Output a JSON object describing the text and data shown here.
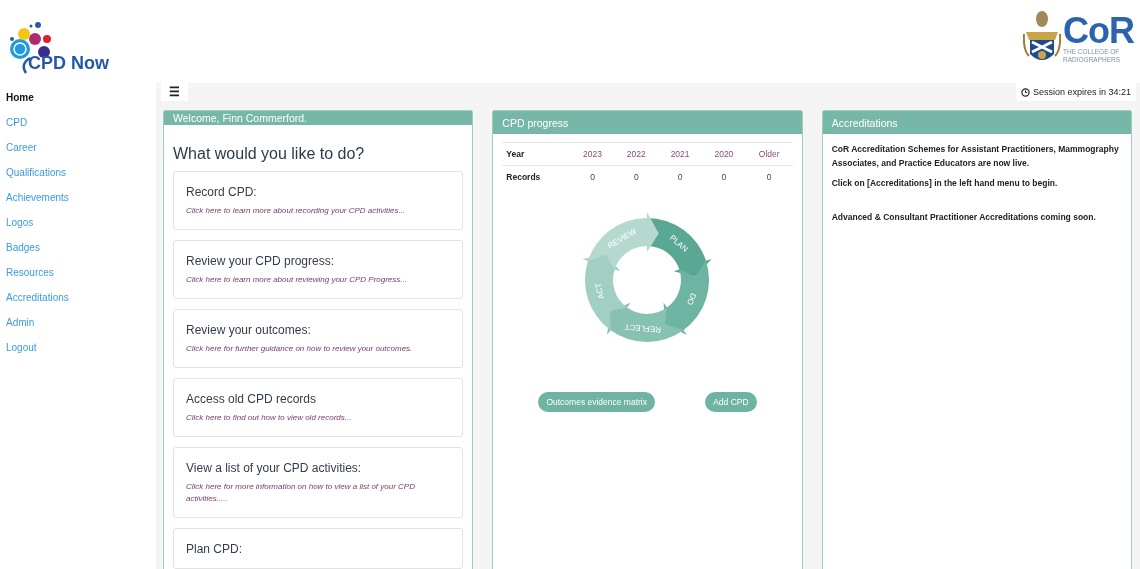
{
  "header": {
    "app_logo_text": "CPD Now",
    "org_logo_text": "CoR",
    "org_name_lines": [
      "THE COLLEGE OF",
      "RADIOGRAPHERS"
    ]
  },
  "sidebar": {
    "items": [
      {
        "label": "Home",
        "selected": true
      },
      {
        "label": "CPD",
        "selected": false
      },
      {
        "label": "Career",
        "selected": false
      },
      {
        "label": "Qualifications",
        "selected": false
      },
      {
        "label": "Achievements",
        "selected": false
      },
      {
        "label": "Logos",
        "selected": false
      },
      {
        "label": "Badges",
        "selected": false
      },
      {
        "label": "Resources",
        "selected": false
      },
      {
        "label": "Accreditations",
        "selected": false
      },
      {
        "label": "Admin",
        "selected": false
      },
      {
        "label": "Logout",
        "selected": false
      }
    ]
  },
  "toolbar": {
    "menu_toggle": "☰",
    "session": {
      "label": "Session expires in",
      "time": "34:21"
    }
  },
  "welcome_panel": {
    "title": "Welcome, Finn Commerford.",
    "heading": "What would you like to do?",
    "cards": [
      {
        "title": "Record CPD:",
        "link": "Click here to learn more about recording your CPD activities..."
      },
      {
        "title": "Review your CPD progress:",
        "link": "Click here to learn more about reviewing your CPD Progress..."
      },
      {
        "title": "Review your outcomes:",
        "link": "Click here for further guidance on how to review your outcomes."
      },
      {
        "title": "Access old CPD records",
        "link": "Click here to find out how to view old records..."
      },
      {
        "title": "View a list of your CPD activities:",
        "link": "Click here for more information on how to view a list of your CPD activities....."
      },
      {
        "title": "Plan CPD:"
      }
    ]
  },
  "progress_panel": {
    "title": "CPD progress",
    "table": {
      "columns": [
        "Year",
        "2023",
        "2022",
        "2021",
        "2020",
        "Older"
      ],
      "rows": [
        [
          "Records",
          "0",
          "0",
          "0",
          "0",
          "0"
        ]
      ]
    },
    "cycle": [
      "PLAN",
      "DO",
      "REFLECT",
      "ACT",
      "REVIEW"
    ],
    "buttons": [
      "Outcomes evidence matrix",
      "Add CPD"
    ]
  },
  "accreditations_panel": {
    "title": "Accreditations",
    "paragraphs": [
      "CoR Accreditation Schemes for Assistant Practitioners, Mammography Associates, and Practice Educators are now live.",
      "Click on [Accreditations] in the left hand menu to begin.",
      "Advanced & Consultant Practitioner Accreditations coming soon."
    ]
  }
}
